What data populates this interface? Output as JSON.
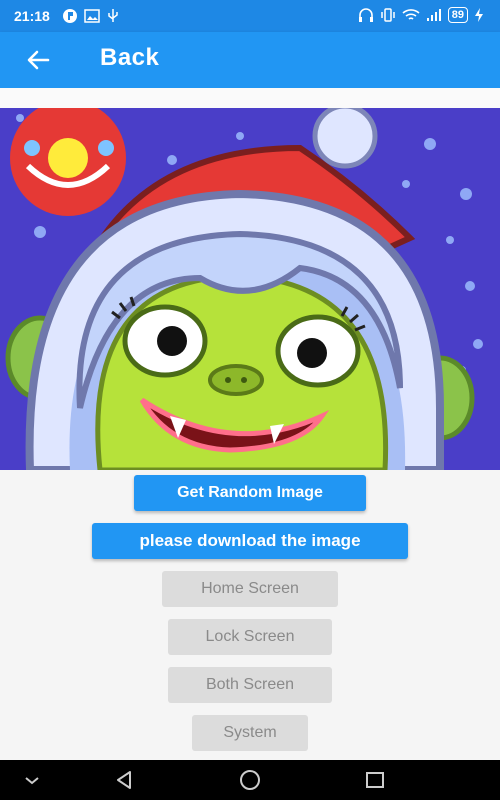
{
  "status_bar": {
    "time": "21:18",
    "battery": "89"
  },
  "app_bar": {
    "title": "Back",
    "back_icon": "arrow-left-icon"
  },
  "image": {
    "description_icon": "christmas-vampire-girl-image"
  },
  "buttons": {
    "get_random": "Get Random Image",
    "download": "please download the image",
    "home_screen": "Home Screen",
    "lock_screen": "Lock Screen",
    "both_screen": "Both Screen",
    "system": "System"
  },
  "colors": {
    "primary": "#2196f3",
    "status": "#1e88e5",
    "disabled_bg": "#dcdcdc",
    "disabled_text": "#8a8a8a"
  }
}
